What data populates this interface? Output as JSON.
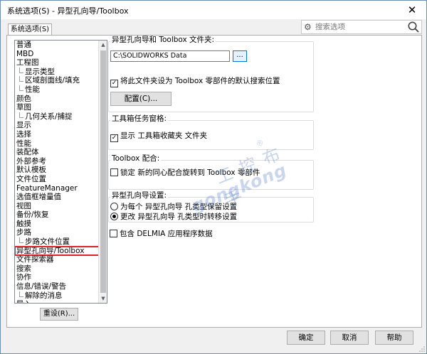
{
  "window": {
    "title": "系统选项(S) - 异型孔向导/Toolbox",
    "close_glyph": "✕"
  },
  "tab": {
    "label": "系统选项(S)"
  },
  "search": {
    "placeholder": "搜索选项",
    "gear_icon": "gear-icon",
    "magnifier_icon": "search-icon"
  },
  "nav": {
    "items": [
      {
        "label": "普通",
        "level": 0
      },
      {
        "label": "MBD",
        "level": 0
      },
      {
        "label": "工程图",
        "level": 0
      },
      {
        "label": "显示类型",
        "level": 1
      },
      {
        "label": "区域剖面线/填充",
        "level": 1
      },
      {
        "label": "性能",
        "level": 1
      },
      {
        "label": "颜色",
        "level": 0
      },
      {
        "label": "草图",
        "level": 0
      },
      {
        "label": "几何关系/捕捉",
        "level": 1
      },
      {
        "label": "显示",
        "level": 0
      },
      {
        "label": "选择",
        "level": 0
      },
      {
        "label": "性能",
        "level": 0
      },
      {
        "label": "装配体",
        "level": 0
      },
      {
        "label": "外部参考",
        "level": 0
      },
      {
        "label": "默认模板",
        "level": 0
      },
      {
        "label": "文件位置",
        "level": 0
      },
      {
        "label": "FeatureManager",
        "level": 0
      },
      {
        "label": "选值框增量值",
        "level": 0
      },
      {
        "label": "视图",
        "level": 0
      },
      {
        "label": "备份/恢复",
        "level": 0
      },
      {
        "label": "触摸",
        "level": 0
      },
      {
        "label": "步路",
        "level": 0
      },
      {
        "label": "步路文件位置",
        "level": 1
      },
      {
        "label": "异型孔向导/Toolbox",
        "level": 0,
        "selected": true
      },
      {
        "label": "文件探索器",
        "level": 0
      },
      {
        "label": "搜索",
        "level": 0
      },
      {
        "label": "协作",
        "level": 0
      },
      {
        "label": "信息/错误/警告",
        "level": 0
      },
      {
        "label": "解除的消息",
        "level": 1
      },
      {
        "label": "导入",
        "level": 0
      }
    ],
    "scroll_up_glyph": "▲",
    "scroll_down_glyph": "▼"
  },
  "reset_button": "重设(R)...",
  "folder_group": {
    "title": "异型孔向导和 Toolbox 文件夹:",
    "path": "C:\\SOLIDWORKS Data",
    "browse_label": "...",
    "default_search_checkbox": {
      "label": "将此文件夹设为 Toolbox 零部件的默认搜索位置",
      "checked": true
    },
    "config_button": "配置(C)..."
  },
  "toolbox_tasks_group": {
    "title": "工具箱任务窗格:",
    "show_favorites": {
      "label": "显示 工具箱收藏夹 文件夹",
      "checked": true
    }
  },
  "toolbox_mate_group": {
    "title": "Toolbox 配合:",
    "lock_mates": {
      "label": "锁定 新的同心配合旋转到 Toolbox 零部件",
      "checked": false
    }
  },
  "hole_settings_group": {
    "title": "异型孔向导设置:",
    "options": [
      {
        "label": "为每个 异型孔向导 孔类型保留设置",
        "selected": false
      },
      {
        "label": "更改 异型孔向导 孔类型时转移设置",
        "selected": true
      }
    ]
  },
  "delmia_checkbox": {
    "label": "包含 DELMIA 应用程序数据",
    "checked": false
  },
  "watermark": {
    "cn": "工 控 布 手",
    "en": "gongkong",
    "reg": "®"
  },
  "footer": {
    "ok": "确定",
    "cancel": "取消",
    "help": "帮助"
  },
  "colors": {
    "selection_outline": "#e0202a",
    "accent_blue": "#0078d7",
    "watermark": "#5a82c8"
  }
}
